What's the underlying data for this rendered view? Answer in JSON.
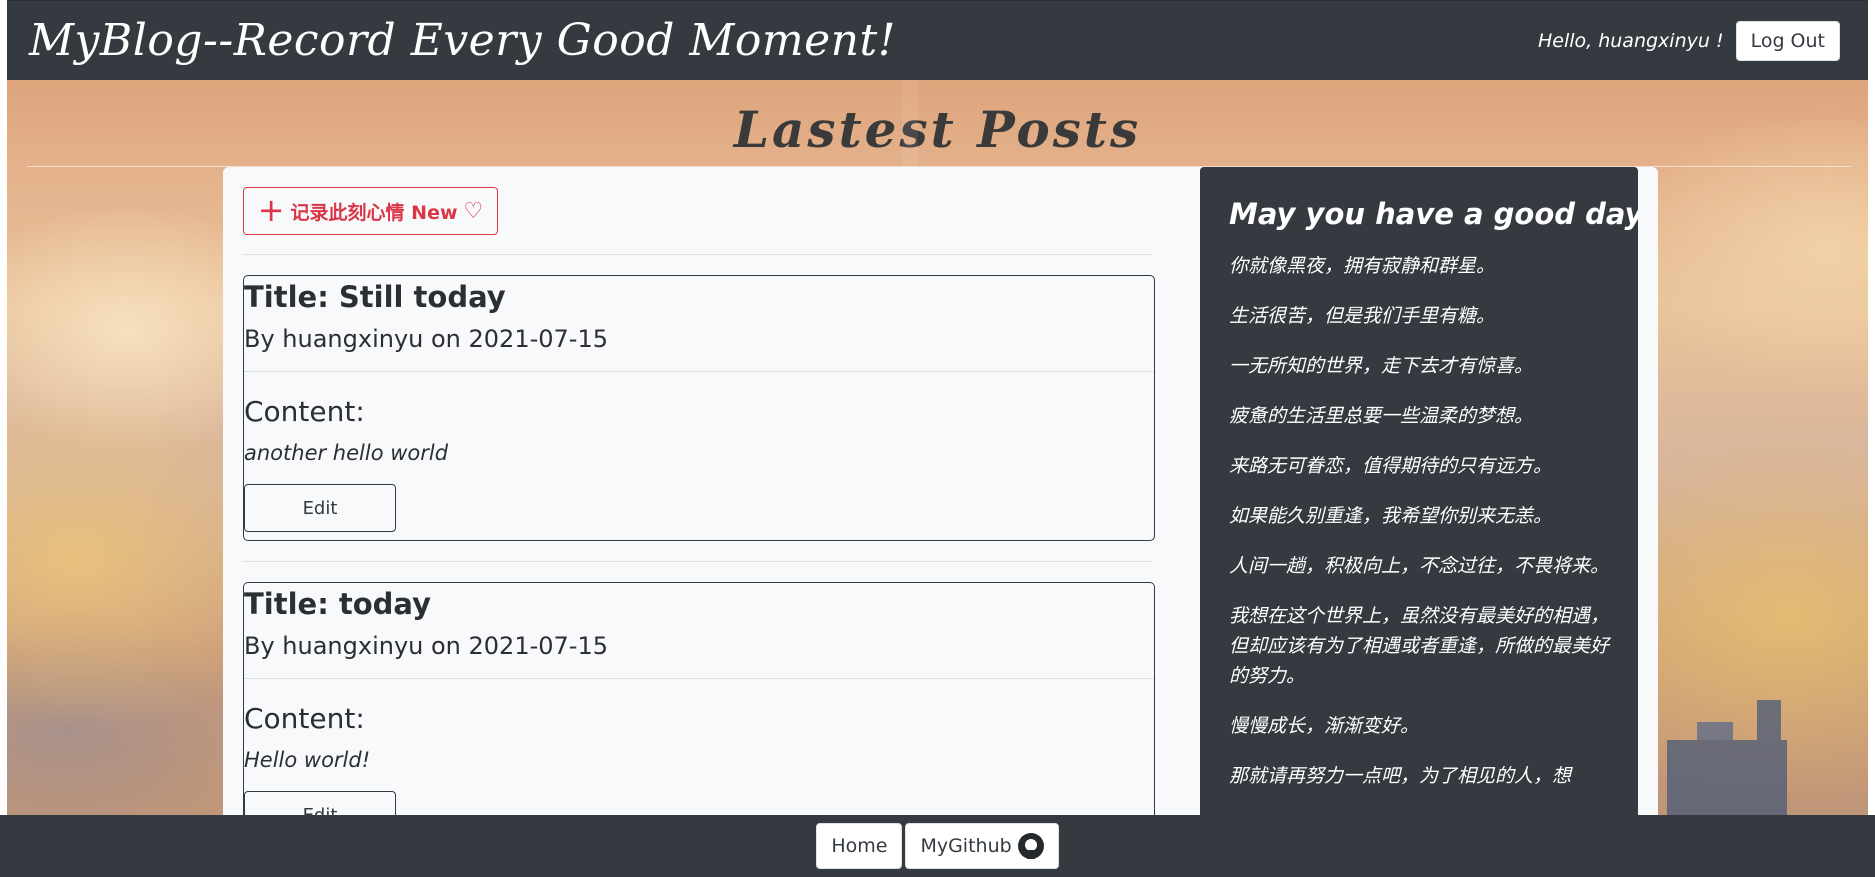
{
  "navbar": {
    "brand": "MyBlog--Record Every Good Moment!",
    "greeting": "Hello, huangxinyu !",
    "logout_label": "Log Out"
  },
  "main": {
    "section_title": "Lastest Posts",
    "new_button_label": "记录此刻心情 New",
    "posts": [
      {
        "title": "Title: Still today",
        "meta": "By huangxinyu on 2021-07-15",
        "content_label": "Content:",
        "body": "another hello world",
        "edit_label": "Edit"
      },
      {
        "title": "Title: today",
        "meta": "By huangxinyu on 2021-07-15",
        "content_label": "Content:",
        "body": "Hello world!",
        "edit_label": "Edit"
      }
    ]
  },
  "sidebar": {
    "heading": "May you have a good day!",
    "quotes": [
      "你就像黑夜，拥有寂静和群星。",
      "生活很苦，但是我们手里有糖。",
      "一无所知的世界，走下去才有惊喜。",
      "疲惫的生活里总要一些温柔的梦想。",
      "来路无可眷恋，值得期待的只有远方。",
      "如果能久别重逢，我希望你别来无恙。",
      "人间一趟，积极向上，不念过往，不畏将来。",
      "我想在这个世界上，虽然没有最美好的相遇，但却应该有为了相遇或者重逢，所做的最美好的努力。",
      "慢慢成长，渐渐变好。",
      "那就请再努力一点吧，为了相见的人，想"
    ]
  },
  "footer": {
    "home_label": "Home",
    "github_label": "MyGithub",
    "github_icon": "github-icon"
  },
  "colors": {
    "dark": "#343a40",
    "danger": "#dc3545",
    "light": "#f8f9fa"
  }
}
